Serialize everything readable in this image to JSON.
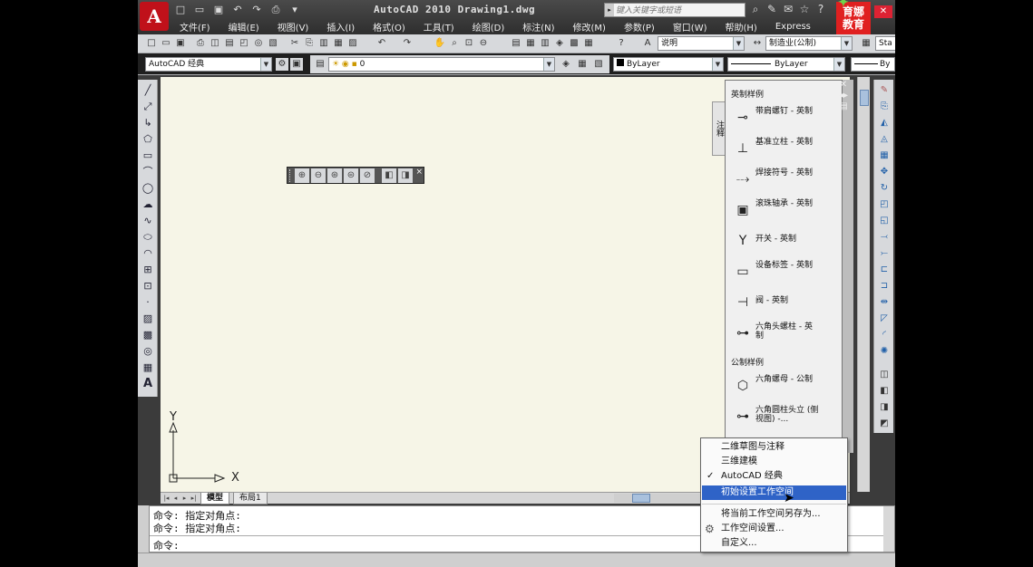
{
  "window": {
    "app_logo": "A",
    "title": "AutoCAD 2010  Drawing1.dwg",
    "search_placeholder": "键入关键字或短语",
    "brand_badge": "育娜 教育"
  },
  "menu": [
    "文件(F)",
    "编辑(E)",
    "视图(V)",
    "插入(I)",
    "格式(O)",
    "工具(T)",
    "绘图(D)",
    "标注(N)",
    "修改(M)",
    "参数(P)",
    "窗口(W)",
    "帮助(H)",
    "Express"
  ],
  "toolbar1": {
    "text_style": "说明",
    "dim_style": "制造业(公制)",
    "table_style": "Sta"
  },
  "toolbar2": {
    "workspace": "AutoCAD 经典",
    "layer": "0",
    "color": "ByLayer",
    "linetype": "ByLayer",
    "lineweight": "By"
  },
  "palette": {
    "tab_label": "注释",
    "section_imperial": "英制样例",
    "section_metric": "公制样例",
    "items": [
      {
        "label": "带肩螺钉 - 英制",
        "icon": "bolt-icon"
      },
      {
        "label": "基准立柱 - 英制",
        "icon": "post-icon"
      },
      {
        "label": "焊接符号 - 英制",
        "icon": "weld-icon"
      },
      {
        "label": "滚珠轴承 - 英制",
        "icon": "bearing-icon"
      },
      {
        "label": "开关 - 英制",
        "icon": "switch-icon"
      },
      {
        "label": "设备标签 - 英制",
        "icon": "tag-icon"
      },
      {
        "label": "阀 - 英制",
        "icon": "valve-icon"
      },
      {
        "label": "六角头螺柱 - 英制",
        "icon": "hex-bolt-icon"
      },
      {
        "label": "六角螺母 - 公制",
        "icon": "hex-nut-icon"
      },
      {
        "label": "六角圆柱头立 (侧视图) -...",
        "icon": "socket-screw-icon"
      }
    ]
  },
  "layout_tabs": [
    "模型",
    "布局1"
  ],
  "command_line": {
    "history": [
      "命令: 指定对角点:",
      "命令: 指定对角点:"
    ],
    "prompt": "命令:"
  },
  "ucs": {
    "x_label": "X",
    "y_label": "Y"
  },
  "workspace_menu": {
    "items": [
      {
        "label": "二维草图与注释",
        "checked": false,
        "highlighted": false
      },
      {
        "label": "三维建模",
        "checked": false,
        "highlighted": false
      },
      {
        "label": "AutoCAD 经典",
        "checked": true,
        "highlighted": false
      },
      {
        "label": "初始设置工作空间",
        "checked": false,
        "highlighted": true
      },
      {
        "label": "将当前工作空间另存为...",
        "checked": false,
        "highlighted": false
      },
      {
        "label": "工作空间设置...",
        "checked": false,
        "highlighted": false
      },
      {
        "label": "自定义...",
        "checked": false,
        "highlighted": false
      }
    ],
    "check_glyph": "✓"
  },
  "colors": {
    "highlight": "#2f63c7",
    "canvas": "#f6f5e7",
    "logo_red": "#c0111a"
  }
}
